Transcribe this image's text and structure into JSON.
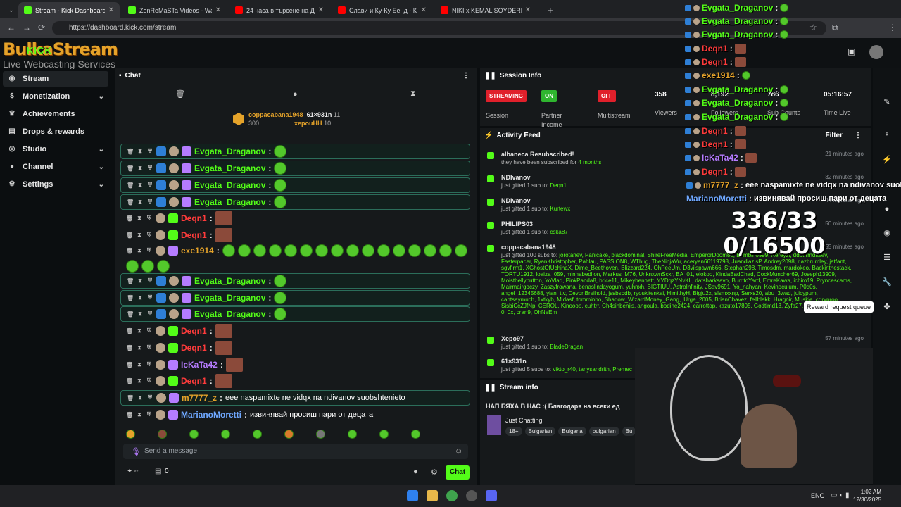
{
  "browser": {
    "tabs": [
      {
        "label": "Stream - Kick Dashboard",
        "color": "#53fc18",
        "active": true
      },
      {
        "label": "ZenReMaSTa Videos - Watch O",
        "color": "#53fc18"
      },
      {
        "label": "24 часа в търсене на Дяволск",
        "color": "#ff0000"
      },
      {
        "label": "Слави и Ку-Ку Бенд - Кой уши",
        "color": "#ff0000"
      },
      {
        "label": "NIKI x KEMAL SOYDERE PARITE",
        "color": "#ff0000"
      }
    ],
    "url": "https://dashboard.kick.com/stream"
  },
  "logo": {
    "line1": "BulkaStream",
    "line2": "KICK",
    "line3": "Live Webcasting Services"
  },
  "sidebar": {
    "items": [
      {
        "label": "Stream"
      },
      {
        "label": "Monetization"
      },
      {
        "label": "Achievements"
      },
      {
        "label": "Drops & rewards"
      },
      {
        "label": "Studio"
      },
      {
        "label": "Channel"
      },
      {
        "label": "Settings"
      }
    ]
  },
  "chat": {
    "title": "Chat",
    "pinned": {
      "user1": "coppacabana1948",
      "val1": "300",
      "user2": "61×931n",
      "val2": "11",
      "user3": "xepouHH",
      "val3": "10"
    },
    "messages": [
      {
        "user": "Evgata_Draganov",
        "color": "#53fc18",
        "hl": true,
        "emotes": 1
      },
      {
        "user": "Evgata_Draganov",
        "color": "#53fc18",
        "hl": true,
        "emotes": 1
      },
      {
        "user": "Evgata_Draganov",
        "color": "#53fc18",
        "hl": true,
        "emotes": 1
      },
      {
        "user": "Evgata_Draganov",
        "color": "#53fc18",
        "hl": true,
        "emotes": 1
      },
      {
        "user": "Deqn1",
        "color": "#ff3b3b",
        "pic": true
      },
      {
        "user": "Deqn1",
        "color": "#ff3b3b",
        "pic": true
      },
      {
        "user": "exe1914",
        "color": "#e5a32a",
        "emotes": 19
      },
      {
        "user": "Evgata_Draganov",
        "color": "#53fc18",
        "hl": true,
        "emotes": 1
      },
      {
        "user": "Evgata_Draganov",
        "color": "#53fc18",
        "hl": true,
        "emotes": 1
      },
      {
        "user": "Evgata_Draganov",
        "color": "#53fc18",
        "hl": true,
        "emotes": 1
      },
      {
        "user": "Deqn1",
        "color": "#ff3b3b",
        "pic": true
      },
      {
        "user": "Deqn1",
        "color": "#ff3b3b",
        "pic": true
      },
      {
        "user": "IcKaTa42",
        "color": "#b57cff",
        "pic": true
      },
      {
        "user": "Deqn1",
        "color": "#ff3b3b",
        "pic": true
      },
      {
        "user": "m7777_z",
        "color": "#e5a32a",
        "hl": true,
        "text": "eee naspamixte ne vidqx na ndivanov suobshtenieto"
      },
      {
        "user": "MarianoMoretti",
        "color": "#6fa8ff",
        "text": "извинявай просиш пари от децата"
      }
    ],
    "input_placeholder": "Send a message",
    "count": "0",
    "send_label": "Chat"
  },
  "session": {
    "title": "Session Info",
    "stats": [
      {
        "pill": "STREAMING",
        "pill_color": "#e0202b",
        "label": "Session"
      },
      {
        "pill": "ON",
        "pill_color": "#2fb52f",
        "label": "Partner Income"
      },
      {
        "pill": "OFF",
        "pill_color": "#e0202b",
        "label": "Multistream"
      },
      {
        "value": "358",
        "label": "Viewers"
      },
      {
        "value": "8,192",
        "label": "Followers"
      },
      {
        "value": "786",
        "label": "Sub Counts"
      },
      {
        "value": "05:16:57",
        "label": "Time Live"
      }
    ]
  },
  "activity": {
    "title": "Activity Feed",
    "filter": "Filter",
    "items": [
      {
        "name": "albaneca Resubscribed!",
        "sub": "they have been subscribed for ",
        "strong": "4 months",
        "time": "21 minutes ago"
      },
      {
        "name": "NDIvanov",
        "sub": "just gifted 1 sub to: ",
        "strong": "Deqn1",
        "time": "32 minutes ago"
      },
      {
        "name": "NDIvanov",
        "sub": "just gifted 1 sub to: ",
        "strong": "Kurtewx",
        "time": "44 minutes ago"
      },
      {
        "name": "PHILIPS03",
        "sub": "just gifted 1 sub to: ",
        "strong": "cska87",
        "time": "50 minutes ago"
      },
      {
        "name": "coppacabana1948",
        "sub": "just gifted 100 subs to: ",
        "strong": "jorotanev, Panicake, blackdominal, ShireFreeMedia, EmperorDoom80, Bambino999, Kereyzi, ddotfrmdasev, Fasterpacer, RyanKhristopher, Pahlau, PASSION8, WThug, TheNinjaVu, aceryan66119798, JuandiazisP, Andrey2098, riazbrumley, jatfant, sgvfirm1, XGhostOfUchihaX, Dime_Beethoven, Blizzard224, OhPeeUm, D3vilspawn666, Stephan298, Timosdm, mardokeo, Backinthestack, TORTU1912, loaiza_059, minnabedlion, Markus_M76, UnknxwnScxr, BA_01, elokoo, KindaBadChad, CockMuncher69, Joseph13909, Moistbellybutton, YoVlad, PinkPanda8, brice11, Mikeybennett, YYDqzYNvKL, datsharksavo, BurritoYard, EmreKawa, ichiro19, Pryncescams, Mairmairgoczy, Zaszyfrowana, benaslindayogum, yuhnxh, BIGTIUU, AstroInfinity, JSav9691, Yo_nahyan, Kevinoculum, P0d0s, angel_12345688, yian_ttv, DevonBreihold, jssbsbdb, ryoukitenkai, HimithyH, Bigju2x, slsmxxnp, Serxs20, abu_3wad, juicypum, cantsaymuch, 1xtkyb, Midasf, tomminho, Shadow_WizardMoney_Gang, jUrge_2005, BrianChavez, fellblakk, Hragnir, Muskie, cgryproo, SisbiCcZJfNp, CEROL, Kinoooo, cuhtrr, Ch4sinbenjis, angoula, bodine2424, carrottop, kazuto17805, Godtimd13, Zyfa27, gabriel_aleixo, 0_0x, cran9, OhNeEm",
        "time": "55 minutes ago"
      },
      {
        "name": "Xepo97",
        "sub": "just gifted 1 sub to: ",
        "strong": "BladeDragan",
        "time": "57 minutes ago"
      },
      {
        "name": "61×931n",
        "sub": "just gifted 5 subs to: ",
        "strong": "vikto_r40, tanysandrith, Premec",
        "time": ""
      }
    ]
  },
  "streaminfo": {
    "title": "Stream info",
    "headline": "НАП БЯХА В НАС :( Благодаря на всеки ед",
    "category": "Just Chatting",
    "tags": [
      "18+",
      "Bulgarian",
      "Bulgaria",
      "bulgarian",
      "Bu"
    ]
  },
  "rightbar": {
    "tooltip": "Reward request queue"
  },
  "overlay": {
    "lines": [
      {
        "user": "Evgata_Draganov",
        "color": "#53fc18"
      },
      {
        "user": "Evgata_Draganov",
        "color": "#53fc18"
      },
      {
        "user": "Evgata_Draganov",
        "color": "#53fc18"
      },
      {
        "user": "Deqn1",
        "color": "#ff3b3b"
      },
      {
        "user": "Deqn1",
        "color": "#ff3b3b"
      },
      {
        "user": "exe1914",
        "color": "#e5a32a"
      },
      {
        "user": "Evgata_Draganov",
        "color": "#53fc18"
      },
      {
        "user": "Evgata_Draganov",
        "color": "#53fc18"
      },
      {
        "user": "Evgata_Draganov",
        "color": "#53fc18"
      },
      {
        "user": "Deqn1",
        "color": "#ff3b3b"
      },
      {
        "user": "Deqn1",
        "color": "#ff3b3b"
      },
      {
        "user": "IcKaTa42",
        "color": "#b57cff"
      },
      {
        "user": "Deqn1",
        "color": "#ff3b3b"
      },
      {
        "user": "m7777_z",
        "color": "#e5a32a",
        "text": "eee naspamixte ne vidqx na ndivanov suobshteni"
      },
      {
        "user": "MarianoMoretti",
        "color": "#6fa8ff",
        "text": "извинявай просиш пари от децата"
      }
    ],
    "count1": "336/33",
    "count2": "0/16500"
  },
  "taskbar": {
    "lang": "ENG",
    "time": "1:02 AM",
    "date": "12/30/2025"
  }
}
